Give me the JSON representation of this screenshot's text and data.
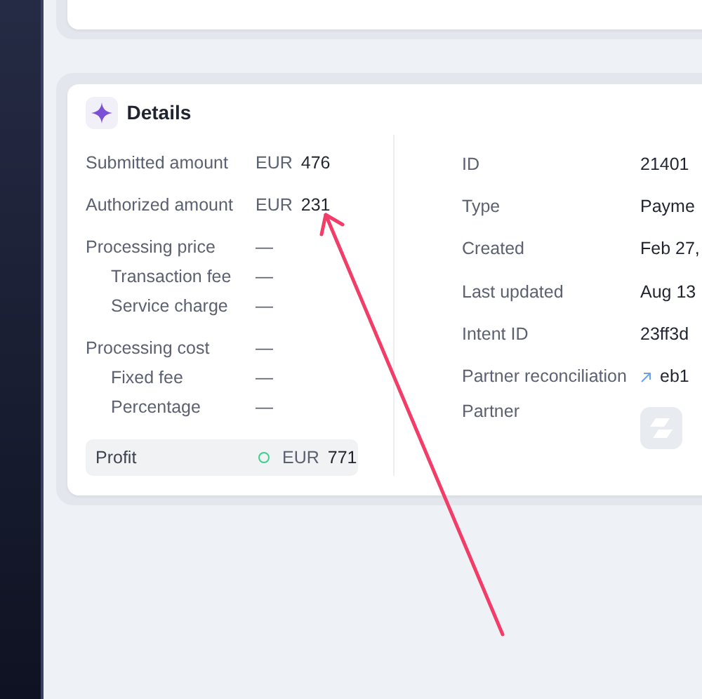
{
  "details": {
    "title": "Details",
    "left_rows": [
      {
        "kind": "amount",
        "label": "Submitted amount",
        "currency": "EUR",
        "value": "476"
      },
      {
        "kind": "amount",
        "label": "Authorized amount",
        "currency": "EUR",
        "value": "231"
      },
      {
        "kind": "group",
        "label": "Processing price",
        "value": "—",
        "children": [
          {
            "label": "Transaction fee",
            "value": "—"
          },
          {
            "label": "Service charge",
            "value": "—"
          }
        ]
      },
      {
        "kind": "group",
        "label": "Processing cost",
        "value": "—",
        "children": [
          {
            "label": "Fixed fee",
            "value": "—"
          },
          {
            "label": "Percentage",
            "value": "—"
          }
        ]
      }
    ],
    "profit": {
      "label": "Profit",
      "currency": "EUR",
      "value": "771",
      "color": "#3ecf8e"
    },
    "right_rows": [
      {
        "kind": "text",
        "label": "ID",
        "value": "21401"
      },
      {
        "kind": "text",
        "label": "Type",
        "value": "Payme"
      },
      {
        "kind": "text",
        "label": "Created",
        "value": "Feb 27,"
      },
      {
        "kind": "text",
        "label": "Last updated",
        "value": "Aug 13"
      },
      {
        "kind": "text",
        "label": "Intent ID",
        "value": "23ff3d"
      },
      {
        "kind": "link",
        "label": "Partner reconciliation",
        "value": "eb1"
      },
      {
        "kind": "logo",
        "label": "Partner"
      }
    ]
  }
}
